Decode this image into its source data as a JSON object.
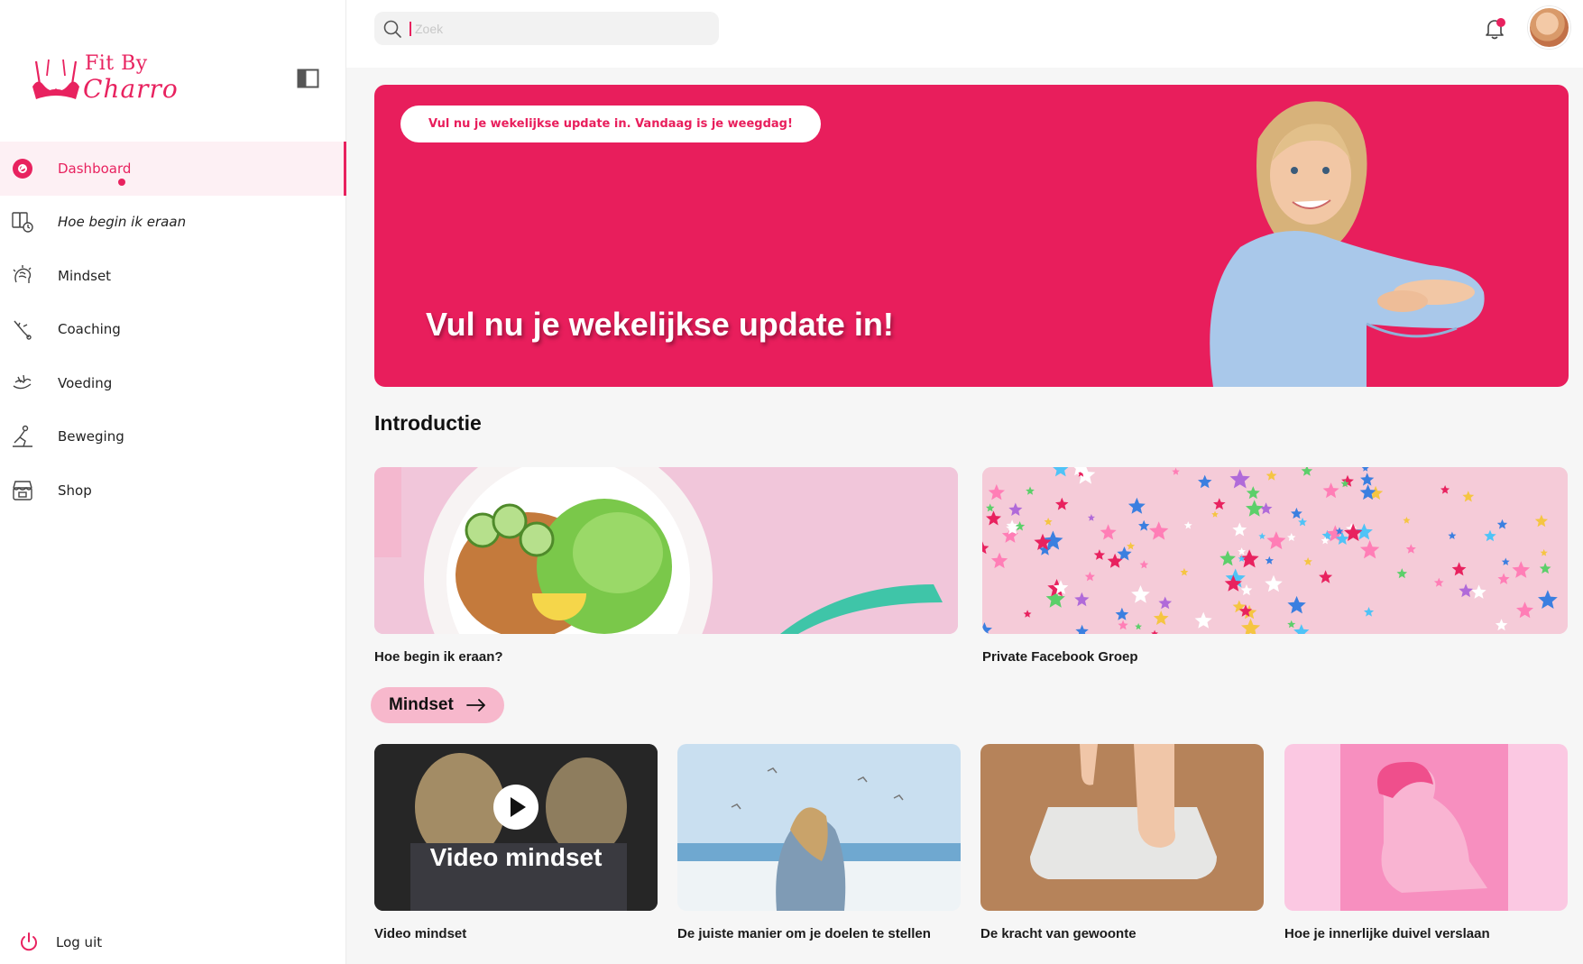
{
  "brand": {
    "name_line1": "Fit By",
    "name_line2": "Charro",
    "accent": "#e8225f"
  },
  "sidebar": {
    "items": [
      {
        "label": "Dashboard",
        "icon": "dashboard-icon",
        "active": true
      },
      {
        "label": "Hoe begin ik eraan",
        "icon": "start-guide-icon",
        "italic": true
      },
      {
        "label": "Mindset",
        "icon": "brain-icon"
      },
      {
        "label": "Coaching",
        "icon": "coaching-icon",
        "badge": true
      },
      {
        "label": "Voeding",
        "icon": "food-icon"
      },
      {
        "label": "Beweging",
        "icon": "exercise-icon"
      },
      {
        "label": "Shop",
        "icon": "shop-icon"
      }
    ],
    "logout_label": "Log uit"
  },
  "topbar": {
    "search_placeholder": "Zoek",
    "notifications": true
  },
  "hero": {
    "pill_label": "Vul nu je wekelijkse update in. Vandaag is je weegdag!",
    "title": "Vul nu je wekelijkse update in!",
    "background": "#e81e5c"
  },
  "intro": {
    "title": "Introductie",
    "cards": [
      {
        "caption": "Hoe begin ik eraan?"
      },
      {
        "caption": "Private Facebook Groep"
      }
    ]
  },
  "mindset": {
    "chip_label": "Mindset",
    "cards": [
      {
        "caption": "Video mindset",
        "overlay": "Video mindset"
      },
      {
        "caption": "De juiste manier om je doelen te stellen"
      },
      {
        "caption": "De kracht van gewoonte"
      },
      {
        "caption": "Hoe je innerlijke duivel verslaan"
      }
    ]
  }
}
